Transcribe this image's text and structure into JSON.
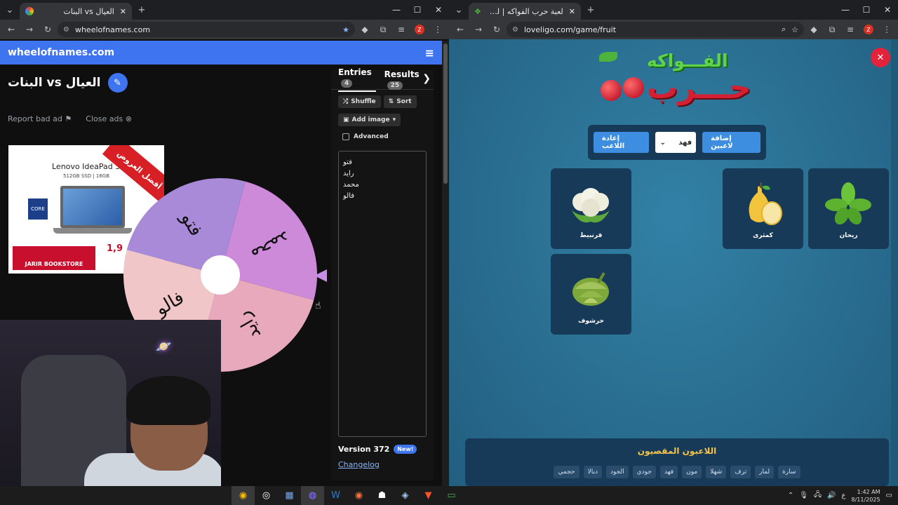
{
  "left": {
    "tab": {
      "title": "العيال vs البنات"
    },
    "url": "wheelofnames.com",
    "site": {
      "brand": "wheelofnames.com",
      "title": "البنات vs العيال",
      "report": "Report bad ad",
      "close_ads": "Close ads"
    },
    "ad": {
      "model": "Lenovo IdeaPad 3",
      "spec": "512GB SSD | 16GB",
      "ribbon": "أفضل العروض",
      "store": "JARIR BOOKSTORE",
      "price": "1,9",
      "intel": "CORE"
    },
    "wheel": {
      "slices": [
        {
          "label": "محمد",
          "color": "#cc8ad9"
        },
        {
          "label": "رايد",
          "color": "#e8a9bd"
        },
        {
          "label": "فالو",
          "color": "#f0c6c9"
        },
        {
          "label": "فتو",
          "color": "#a98ad9"
        }
      ]
    },
    "panel": {
      "entries_tab": "Entries",
      "entries_count": "4",
      "results_tab": "Results",
      "results_count": "25",
      "shuffle": "Shuffle",
      "sort": "Sort",
      "add_image": "Add image",
      "advanced": "Advanced",
      "entries": [
        "فتو",
        "رايد",
        "محمد",
        "فالو"
      ],
      "version": "Version 372",
      "new_badge": "New!",
      "changelog": "Changelog"
    }
  },
  "right": {
    "tab": {
      "title": "لعبة حرب الفواكه | لوف ليجو يوث"
    },
    "url": "loveligo.com/game/fruit",
    "logo": {
      "top": "الفـــواكه",
      "bottom": "حـــرب"
    },
    "controls": {
      "add_players": "إضافة لاعبين",
      "selected_player": "فهد",
      "reset_player": "إعادة اللاعب"
    },
    "cards": [
      {
        "name": "قرنبيط"
      },
      {
        "name": "كمثرى"
      },
      {
        "name": "ريحان"
      },
      {
        "name": "خرشوف"
      }
    ],
    "eliminated": {
      "title": "اللاعبون المقصيون",
      "players": [
        "حجمي",
        "دبالا",
        "الجود",
        "جودي",
        "فهد",
        "مون",
        "شهلا",
        "ترف",
        "لمار",
        "سارة"
      ]
    }
  },
  "taskbar": {
    "time": "1:42 AM",
    "date": "8/11/2025",
    "lang": "ع"
  }
}
